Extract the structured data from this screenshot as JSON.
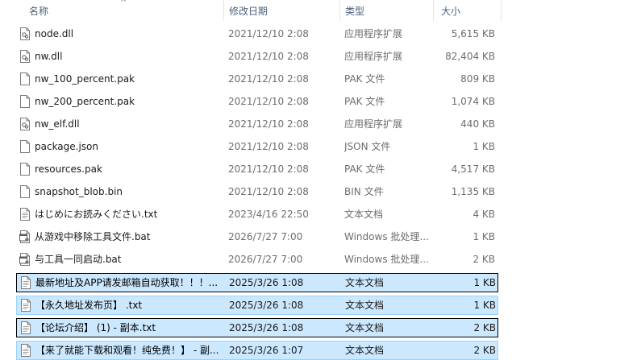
{
  "columns": {
    "name": "名称",
    "date": "修改日期",
    "type": "类型",
    "size": "大小"
  },
  "sort_indicator": "^",
  "files": [
    {
      "name": "node.dll",
      "date": "2021/12/10 2:08",
      "type": "应用程序扩展",
      "size": "5,615 KB",
      "icon": "dll-file-icon",
      "selected": false,
      "focused": false
    },
    {
      "name": "nw.dll",
      "date": "2021/12/10 2:08",
      "type": "应用程序扩展",
      "size": "82,404 KB",
      "icon": "dll-file-icon",
      "selected": false,
      "focused": false
    },
    {
      "name": "nw_100_percent.pak",
      "date": "2021/12/10 2:08",
      "type": "PAK 文件",
      "size": "809 KB",
      "icon": "blank-file-icon",
      "selected": false,
      "focused": false
    },
    {
      "name": "nw_200_percent.pak",
      "date": "2021/12/10 2:08",
      "type": "PAK 文件",
      "size": "1,074 KB",
      "icon": "blank-file-icon",
      "selected": false,
      "focused": false
    },
    {
      "name": "nw_elf.dll",
      "date": "2021/12/10 2:08",
      "type": "应用程序扩展",
      "size": "440 KB",
      "icon": "dll-file-icon",
      "selected": false,
      "focused": false
    },
    {
      "name": "package.json",
      "date": "2021/12/10 2:08",
      "type": "JSON 文件",
      "size": "1 KB",
      "icon": "blank-file-icon",
      "selected": false,
      "focused": false
    },
    {
      "name": "resources.pak",
      "date": "2021/12/10 2:08",
      "type": "PAK 文件",
      "size": "4,517 KB",
      "icon": "blank-file-icon",
      "selected": false,
      "focused": false
    },
    {
      "name": "snapshot_blob.bin",
      "date": "2021/12/10 2:08",
      "type": "BIN 文件",
      "size": "1,135 KB",
      "icon": "blank-file-icon",
      "selected": false,
      "focused": false
    },
    {
      "name": "はじめにお読みください.txt",
      "date": "2023/4/16 22:50",
      "type": "文本文档",
      "size": "4 KB",
      "icon": "text-file-icon",
      "selected": false,
      "focused": false
    },
    {
      "name": "从游戏中移除工具文件.bat",
      "date": "2026/7/27 7:00",
      "type": "Windows 批处理...",
      "size": "1 KB",
      "icon": "batch-file-icon",
      "selected": false,
      "focused": false
    },
    {
      "name": "与工具一同启动.bat",
      "date": "2026/7/27 7:00",
      "type": "Windows 批处理...",
      "size": "2 KB",
      "icon": "batch-file-icon",
      "selected": false,
      "focused": false
    },
    {
      "name": "最新地址及APP请发邮箱自动获取！！！...",
      "date": "2025/3/26 1:08",
      "type": "文本文档",
      "size": "1 KB",
      "icon": "text-file-icon",
      "selected": true,
      "focused": true
    },
    {
      "name": "【永久地址发布页】 .txt",
      "date": "2025/3/26 1:08",
      "type": "文本文档",
      "size": "1 KB",
      "icon": "text-file-icon",
      "selected": true,
      "focused": false
    },
    {
      "name": "【论坛介绍】 (1) - 副本.txt",
      "date": "2025/3/26 1:08",
      "type": "文本文档",
      "size": "2 KB",
      "icon": "text-file-icon",
      "selected": true,
      "focused": true
    },
    {
      "name": "【来了就能下载和观看！纯免费！】 - 副...",
      "date": "2025/3/26 1:07",
      "type": "文本文档",
      "size": "2 KB",
      "icon": "text-file-icon",
      "selected": true,
      "focused": false
    }
  ]
}
